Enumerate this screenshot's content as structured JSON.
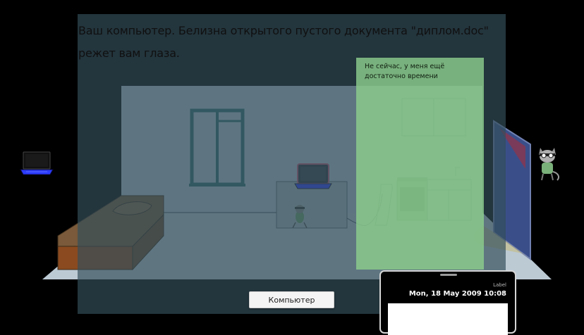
{
  "narration": {
    "text": "Ваш компьютер. Белизна открытого пустого документа \"диплом.doc\" режет вам глаза."
  },
  "choice": {
    "label": "Не сейчас, у меня ещё достаточно времени"
  },
  "action_button": {
    "label": "Компьютер"
  },
  "phone": {
    "label": "Label",
    "datetime": "Mon, 18 May 2009 10:08"
  },
  "icons": {
    "laptop": "laptop-icon",
    "character": "cat-character-icon"
  },
  "colors": {
    "overlay": "#344e5a",
    "choice_panel": "#8ccd8c",
    "room_wall": "#b7c7d2",
    "window_frame": "#2f6f73",
    "laptop_screen": "#2c3cff"
  }
}
